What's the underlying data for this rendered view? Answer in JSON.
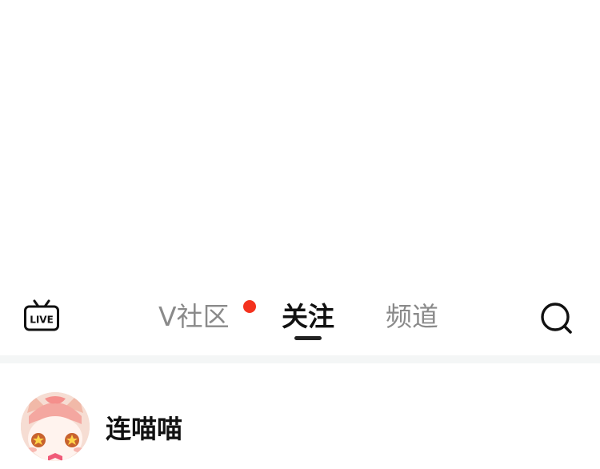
{
  "topnav": {
    "live_icon_label": "LIVE",
    "tabs": [
      {
        "label": "V社区",
        "active": false,
        "has_dot": true
      },
      {
        "label": "关注",
        "active": true,
        "has_dot": false
      },
      {
        "label": "频道",
        "active": false,
        "has_dot": false
      }
    ],
    "icons": {
      "left": "live-tv-icon",
      "right": "search-icon"
    },
    "colors": {
      "active_text": "#111111",
      "inactive_text": "#8a8a8a",
      "dot": "#f4321e"
    }
  },
  "feed": {
    "items": [
      {
        "username": "连喵喵",
        "avatar": "cat-avatar"
      }
    ]
  }
}
